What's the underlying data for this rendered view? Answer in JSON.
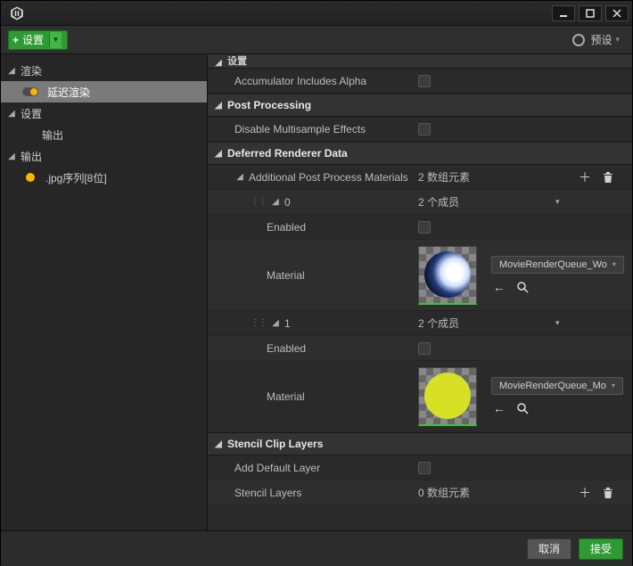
{
  "toolbar": {
    "add_label": "设置",
    "preset_label": "预设"
  },
  "sidebar": {
    "groups": [
      {
        "label": "渲染",
        "children": [
          {
            "label": "延迟渲染",
            "selected": true
          }
        ]
      },
      {
        "label": "设置",
        "children": [
          {
            "label": "输出"
          }
        ]
      },
      {
        "label": "输出",
        "children": [
          {
            "label": ".jpg序列[8位]"
          }
        ]
      }
    ]
  },
  "content": {
    "cutoff_section": "设置",
    "rows": {
      "accum_alpha": "Accumulator Includes Alpha"
    },
    "sections": {
      "postproc": {
        "title": "Post Processing",
        "rows": {
          "disable_ms": "Disable Multisample Effects"
        }
      },
      "deferred": {
        "title": "Deferred Renderer Data",
        "appm_label": "Additional Post Process Materials",
        "appm_value": "2 数组元素",
        "member_label": "2 个成员",
        "idx0": "0",
        "idx1": "1",
        "enabled": "Enabled",
        "material": "Material",
        "mat0_name": "MovieRenderQueue_Wo",
        "mat1_name": "MovieRenderQueue_Mo"
      },
      "stencil": {
        "title": "Stencil Clip Layers",
        "add_default": "Add Default Layer",
        "layers_label": "Stencil Layers",
        "layers_value": "0 数组元素"
      }
    }
  },
  "footer": {
    "cancel": "取消",
    "accept": "接受"
  }
}
